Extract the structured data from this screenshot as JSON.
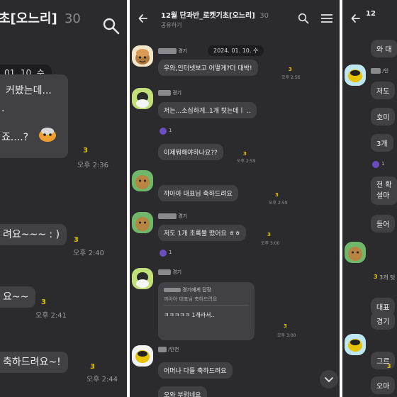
{
  "left": {
    "title": "초[오느리]",
    "count": "30",
    "date": "01. 10. 수",
    "messages": [
      {
        "lines": [
          "커봤는데...",
          "·",
          "죠....?"
        ],
        "unread": "3",
        "time": "오후 2:36"
      },
      {
        "text": "려요~~~ : )",
        "unread": "3",
        "time": "오후 2:40"
      },
      {
        "text": "요~~",
        "unread": "3",
        "time": "오후 2:41"
      },
      {
        "text": "축하드려요~!",
        "unread": "3",
        "time": "오후 2:44"
      }
    ]
  },
  "middle": {
    "title": "12월 단과반_로켓기초[오느리]",
    "count": "30",
    "subtitle": "공유하기",
    "date": "2024. 01. 10. 수",
    "messages": [
      {
        "name": "경기",
        "text": "우와,인터넷보고 어떻게?더 대박!",
        "unread": "3",
        "time": "오후 2:56"
      },
      {
        "name": "경기",
        "text": "저는...소심하게..1개 텃는데ㅣ ..",
        "reaction_count": "1"
      },
      {
        "text": "이제뭐해야하나요??",
        "unread": "3",
        "time": "오후 2:59"
      },
      {
        "text": "꺄아아     대표님 축하드려요",
        "unread": "3",
        "time": "오후 2:59"
      },
      {
        "name": "경기",
        "text": "저도 1개 초록불 떴어요 ㅎㅎ",
        "unread": "3",
        "time": "오후 3:00",
        "reaction_count": "1"
      },
      {
        "name": "경기",
        "reply_header": "경기에게 답장",
        "reply_quote": "꺄아아      대표님 축하드려요",
        "text": "ㅋㅋㅋㅋㅋ 1개라서..",
        "unread": "3",
        "time": "오후 3:00"
      },
      {
        "name": "/인천",
        "text": "어머나 다들 축하드려요"
      },
      {
        "text": "오와 부럽네요"
      }
    ]
  },
  "right": {
    "lines": [
      "와 대",
      "/인",
      "저도",
      "호미",
      "3개",
      "1",
      "전 확",
      "설마",
      "들어",
      "대표",
      "경기",
      "그르",
      "오마"
    ],
    "unread": [
      "3",
      "3"
    ],
    "count_label": "3개 텃"
  },
  "colors": {
    "bg": "#2b2b2e",
    "bubble": "#414145",
    "unread": "#e8c300",
    "reaction": "#6a4fc2"
  }
}
